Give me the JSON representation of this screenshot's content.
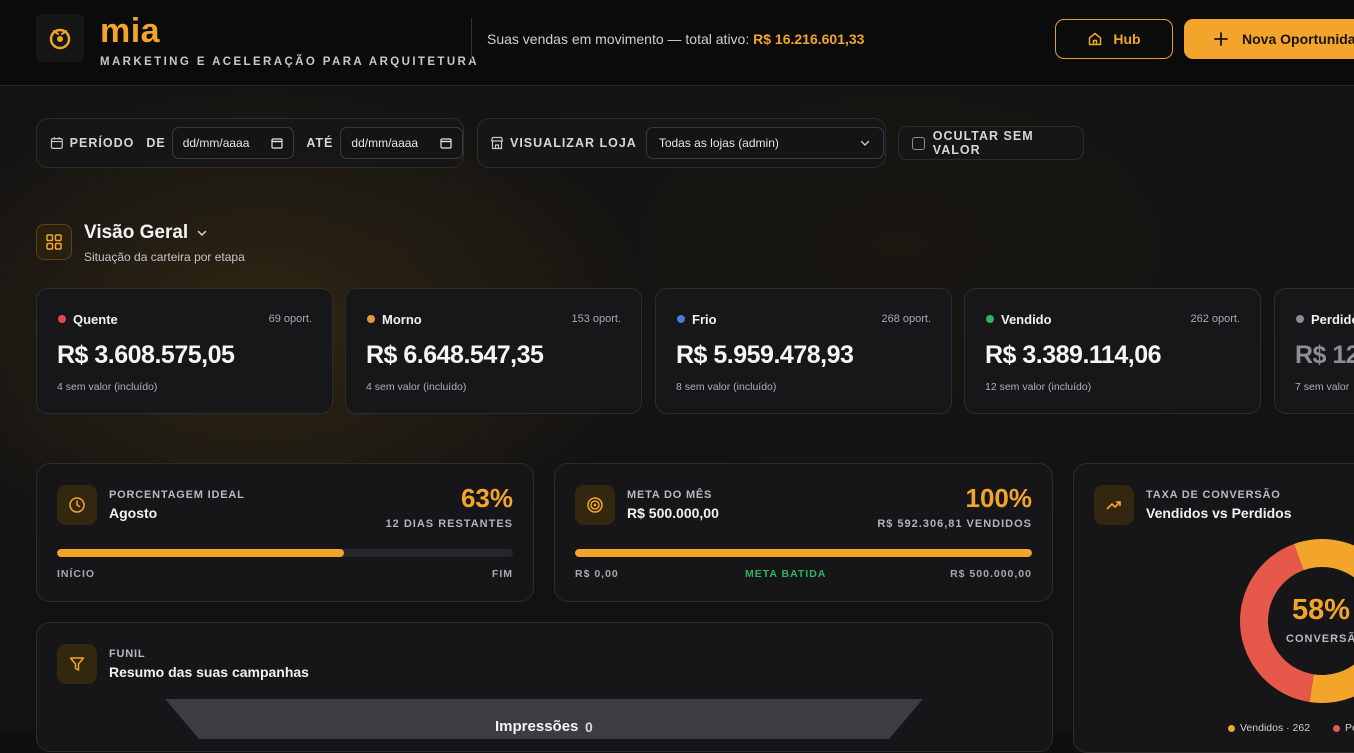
{
  "header": {
    "brand": "mia",
    "tagline": "MARKETING E ACELERAÇÃO PARA ARQUITETURA",
    "status_prefix": "Suas vendas em movimento — total ativo: ",
    "status_amount": "R$ 16.216.601,33",
    "hub_label": "Hub",
    "new_label": "Nova Oportunidade",
    "colors": {
      "accent": "#f2a52a",
      "background": "#0b0b0c"
    }
  },
  "filters": {
    "period_label": "PERÍODO",
    "from_label": "DE",
    "from_value": "dd/mm/aaaa",
    "to_label": "ATÉ",
    "to_value": "dd/mm/aaaa",
    "store_label": "VISUALIZAR LOJA",
    "store_value": "Todas as lojas (admin)",
    "hide_label": "OCULTAR SEM VALOR",
    "hide_checked": false
  },
  "overview": {
    "title": "Visão Geral",
    "subtitle": "Situação da carteira por etapa",
    "stages": [
      {
        "name": "Quente",
        "count": "69 oport.",
        "value": "R$ 3.608.575,05",
        "note": "4 sem valor (incluído)",
        "color": "#e5484d"
      },
      {
        "name": "Morno",
        "count": "153 oport.",
        "value": "R$ 6.648.547,35",
        "note": "4 sem valor (incluído)",
        "color": "#e8963a"
      },
      {
        "name": "Frio",
        "count": "268 oport.",
        "value": "R$ 5.959.478,93",
        "note": "8 sem valor (incluído)",
        "color": "#4b7bd6"
      },
      {
        "name": "Vendido",
        "count": "262 oport.",
        "value": "R$ 3.389.114,06",
        "note": "12 sem valor (incluído)",
        "color": "#2fb35f"
      },
      {
        "name": "Perdido",
        "count": "",
        "value": "R$ 12",
        "note": "7 sem valor",
        "color": "#8b8b90"
      }
    ]
  },
  "ideal": {
    "overline": "PORCENTAGEM IDEAL",
    "title": "Agosto",
    "percent_text": "63%",
    "percent": 63,
    "remaining": "12 DIAS RESTANTES",
    "start_label": "INÍCIO",
    "end_label": "FIM"
  },
  "goal": {
    "overline": "META DO MÊS",
    "title": "R$ 500.000,00",
    "percent_text": "100%",
    "percent": 100,
    "sold": "R$ 592.306,81 VENDIDOS",
    "min_label": "R$ 0,00",
    "status_label": "META BATIDA",
    "max_label": "R$ 500.000,00",
    "status_color": "#2fb35f"
  },
  "conversion": {
    "overline": "TAXA DE CONVERSÃO",
    "title": "Vendidos vs Perdidos",
    "percent_text": "58%",
    "percent": 58,
    "center_label": "CONVERSÃO",
    "legend_sold": "Vendidos · 262",
    "legend_lost": "Pe",
    "colors": {
      "sold": "#f2a52a",
      "lost": "#e5584a"
    }
  },
  "funnel": {
    "overline": "FUNIL",
    "title": "Resumo das suas campanhas",
    "stage_label": "Impressões",
    "stage_value": "0"
  }
}
